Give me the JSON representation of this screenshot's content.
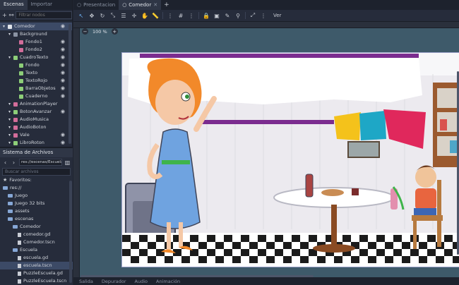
{
  "left_dock": {
    "tabs": [
      "Escenas",
      "Importar"
    ],
    "filter_placeholder": "Filtrar nodos",
    "tree": [
      {
        "label": "Comedor",
        "indent": 0,
        "icon_color": "#e0e4ea",
        "eye": true,
        "selected": true
      },
      {
        "label": "Background",
        "indent": 1,
        "icon_color": "#8a93a3",
        "eye": false
      },
      {
        "label": "Fondo1",
        "indent": 2,
        "icon_color": "#d26d9a",
        "eye": true
      },
      {
        "label": "Fondo2",
        "indent": 2,
        "icon_color": "#d26d9a",
        "eye": true
      },
      {
        "label": "CuadroTexto",
        "indent": 1,
        "icon_color": "#8dce78",
        "eye": true
      },
      {
        "label": "Fondo",
        "indent": 2,
        "icon_color": "#8dce78",
        "eye": true
      },
      {
        "label": "Texto",
        "indent": 2,
        "icon_color": "#8dce78",
        "eye": true
      },
      {
        "label": "TextoRojo",
        "indent": 2,
        "icon_color": "#8dce78",
        "eye": true
      },
      {
        "label": "BarraObjetos",
        "indent": 2,
        "icon_color": "#8dce78",
        "eye": true
      },
      {
        "label": "Cuaderno",
        "indent": 2,
        "icon_color": "#8dce78",
        "eye": true
      },
      {
        "label": "AnimationPlayer",
        "indent": 1,
        "icon_color": "#d26d9a",
        "eye": false
      },
      {
        "label": "BotonAvanzar",
        "indent": 1,
        "icon_color": "#8dce78",
        "eye": true
      },
      {
        "label": "AudioMusica",
        "indent": 1,
        "icon_color": "#d26d9a",
        "eye": false
      },
      {
        "label": "AudioBoton",
        "indent": 1,
        "icon_color": "#d26d9a",
        "eye": false
      },
      {
        "label": "Vale",
        "indent": 1,
        "icon_color": "#d26d9a",
        "eye": true
      },
      {
        "label": "LibroRoton",
        "indent": 1,
        "icon_color": "#8dce78",
        "eye": true
      }
    ]
  },
  "file_system": {
    "title": "Sistema de Archivos",
    "path": "res://escenas/Escuela/",
    "search_placeholder": "Buscar archivos",
    "items": [
      {
        "label": "Favoritos:",
        "indent": 0,
        "kind": "star"
      },
      {
        "label": "res://",
        "indent": 0,
        "kind": "folder"
      },
      {
        "label": "Juego",
        "indent": 1,
        "kind": "folder"
      },
      {
        "label": "Juego 32 bits",
        "indent": 1,
        "kind": "folder"
      },
      {
        "label": "assets",
        "indent": 1,
        "kind": "folder"
      },
      {
        "label": "escenas",
        "indent": 1,
        "kind": "folder"
      },
      {
        "label": "Comedor",
        "indent": 2,
        "kind": "folder"
      },
      {
        "label": "comedor.gd",
        "indent": 3,
        "kind": "file"
      },
      {
        "label": "Comedor.tscn",
        "indent": 3,
        "kind": "file"
      },
      {
        "label": "Escuela",
        "indent": 2,
        "kind": "folder"
      },
      {
        "label": "escuela.gd",
        "indent": 3,
        "kind": "file"
      },
      {
        "label": "escuela.tscn",
        "indent": 3,
        "kind": "file",
        "selected": true
      },
      {
        "label": "PuzzleEscuela.gd",
        "indent": 3,
        "kind": "file"
      },
      {
        "label": "PuzzleEscuela.tscn",
        "indent": 3,
        "kind": "file"
      }
    ]
  },
  "main_tabs": [
    {
      "label": "Presentacion",
      "active": false
    },
    {
      "label": "Comedor",
      "active": true
    }
  ],
  "toolbar": {
    "ver_label": "Ver"
  },
  "viewport": {
    "zoom_label": "100 %"
  },
  "bottom_panel": [
    "Salida",
    "Depurador",
    "Audio",
    "Animación"
  ]
}
